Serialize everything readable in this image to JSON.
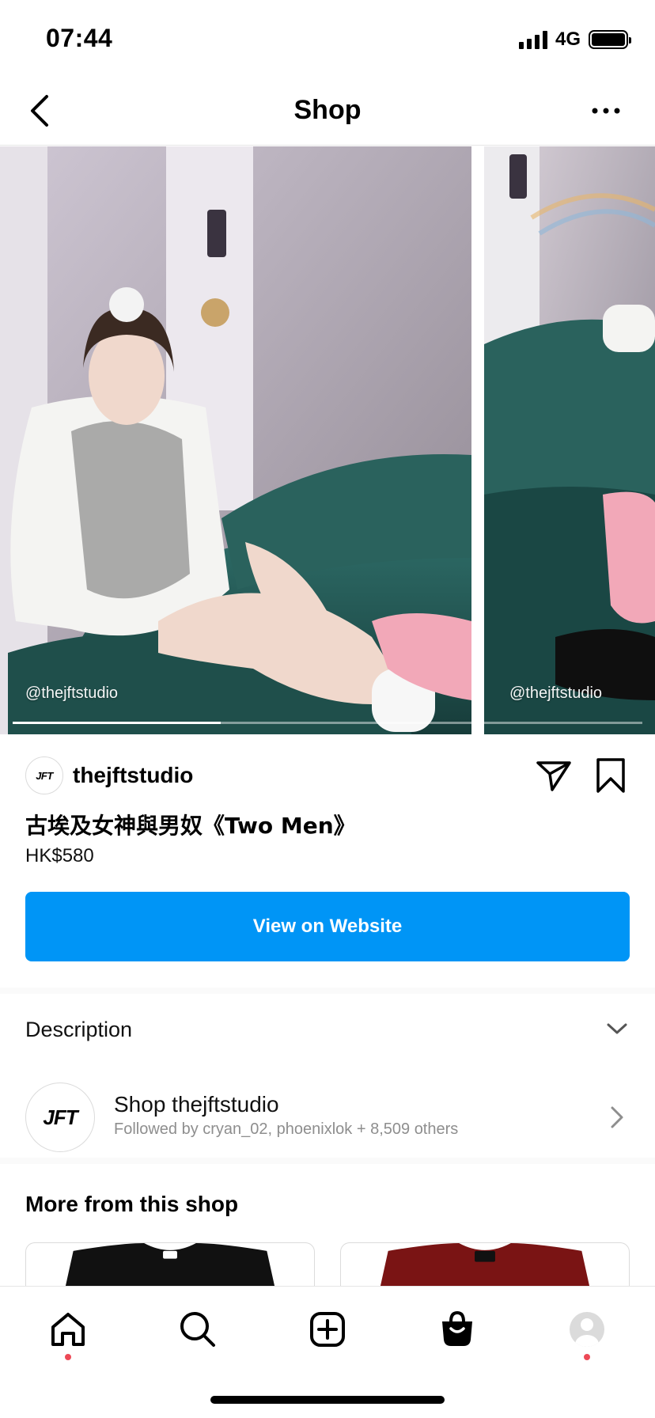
{
  "status_bar": {
    "time": "07:44",
    "network": "4G",
    "icons": [
      "signal-bars-icon",
      "battery-icon"
    ]
  },
  "header": {
    "title": "Shop",
    "back_icon": "chevron-left-icon",
    "more_icon": "more-horizontal-icon"
  },
  "carousel": {
    "slides": [
      {
        "watermark": "@thejftstudio"
      },
      {
        "watermark": "@thejftstudio"
      }
    ],
    "progress": 0.33
  },
  "product": {
    "shop_name": "thejftstudio",
    "shop_logo_text": "JFT",
    "title": "古埃及女神與男奴《Two Men》",
    "price": "HK$580",
    "cta_label": "View on Website",
    "cta_color": "#0095f6",
    "share_icon": "paper-plane-icon",
    "save_icon": "bookmark-icon"
  },
  "description": {
    "label": "Description",
    "icon": "chevron-down-icon"
  },
  "shop_row": {
    "title": "Shop thejftstudio",
    "subtitle": "Followed by cryan_02, phoenixlok + 8,509 others",
    "logo_text": "JFT",
    "icon": "chevron-right-icon"
  },
  "more_from_shop": {
    "title": "More from this shop",
    "items": [
      {
        "shirt_color": "#111111"
      },
      {
        "shirt_color": "#7a1414"
      }
    ]
  },
  "tab_bar": {
    "tabs": [
      "home-icon",
      "search-icon",
      "create-icon",
      "shop-bag-icon",
      "profile-icon"
    ],
    "notification_color": "#ed4956"
  }
}
